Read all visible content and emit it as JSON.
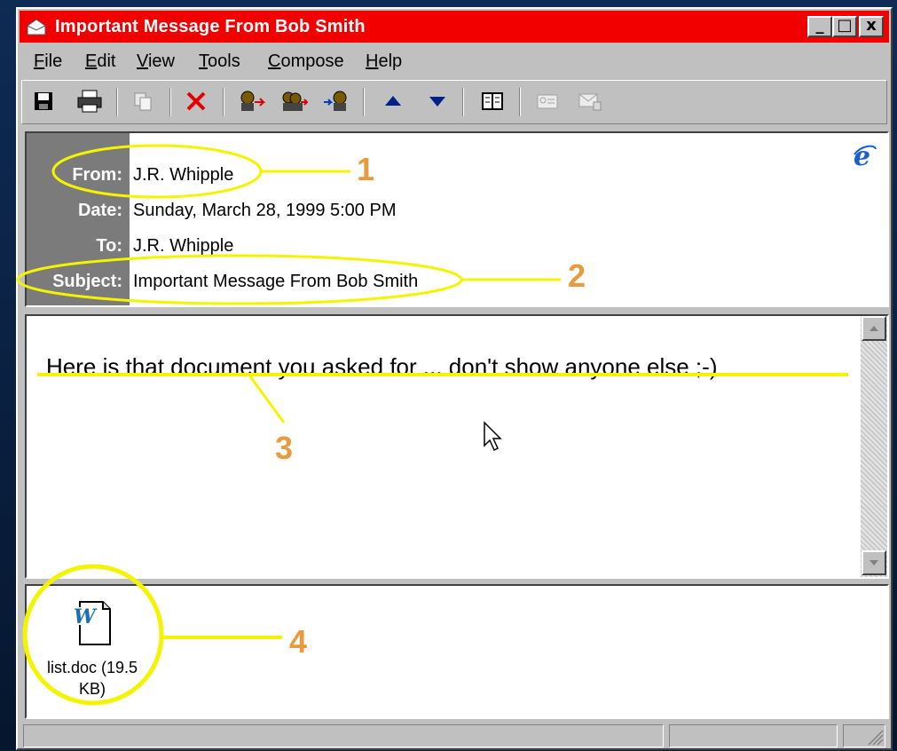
{
  "window": {
    "title": "Important Message From Bob Smith",
    "controls": [
      "_",
      "□",
      "x"
    ]
  },
  "menu": {
    "items": [
      {
        "first": "F",
        "rest": "ile"
      },
      {
        "first": "E",
        "rest": "dit"
      },
      {
        "first": "V",
        "rest": "iew"
      },
      {
        "first": "T",
        "rest": "ools"
      },
      {
        "first": "C",
        "rest": "ompose"
      },
      {
        "first": "H",
        "rest": "elp"
      }
    ]
  },
  "toolbar": {
    "icons": [
      "save-icon",
      "print-icon",
      "copy-icon",
      "delete-icon",
      "reply-icon",
      "reply-all-icon",
      "forward-icon",
      "previous-icon",
      "next-icon",
      "address-book-icon",
      "encrypt-icon",
      "sign-icon"
    ]
  },
  "header": {
    "from_label": "From:",
    "from_value": "J.R. Whipple",
    "date_label": "Date:",
    "date_value": "Sunday, March 28, 1999 5:00 PM",
    "to_label": "To:",
    "to_value": "J.R. Whipple",
    "subject_label": "Subject:",
    "subject_value": "Important Message From Bob Smith"
  },
  "body": {
    "text": "Here is that document you asked for ... don't show anyone else ;-)"
  },
  "attachment": {
    "line1": "list.doc (19.5",
    "line2": "KB)"
  },
  "annotations": {
    "n1": "1",
    "n2": "2",
    "n3": "3",
    "n4": "4"
  },
  "colors": {
    "titlebar": "#f20000",
    "highlight": "#f4f400",
    "annotation_number": "#e89b3c"
  }
}
